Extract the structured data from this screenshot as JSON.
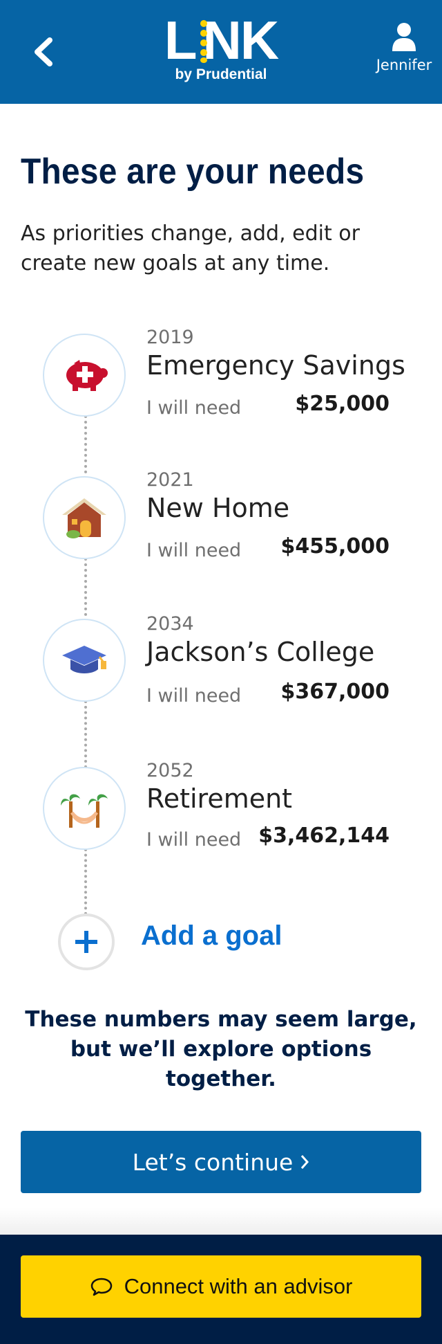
{
  "header": {
    "logo_word": "LINK",
    "logo_sub": "by Prudential",
    "user_name": "Jennifer"
  },
  "main": {
    "title": "These are your needs",
    "intro": "As priorities change, add, edit or create new goals at any time."
  },
  "goals": [
    {
      "year": "2019",
      "title": "Emergency Savings",
      "need_label": "I will need",
      "amount": "$25,000",
      "icon": "piggy-bank-icon"
    },
    {
      "year": "2021",
      "title": "New Home",
      "need_label": "I will need",
      "amount": "$455,000",
      "icon": "house-icon"
    },
    {
      "year": "2034",
      "title": "Jackson’s College",
      "need_label": "I will need",
      "amount": "$367,000",
      "icon": "graduation-cap-icon"
    },
    {
      "year": "2052",
      "title": "Retirement",
      "need_label": "I will need",
      "amount": "$3,462,144",
      "icon": "palm-tree-hammock-icon"
    }
  ],
  "add_goal": {
    "label": "Add a goal"
  },
  "note": "These numbers may seem large, but we’ll explore options together.",
  "continue_label": "Let’s continue",
  "footer": {
    "advisor_label": "Connect with an advisor"
  },
  "colors": {
    "brand_blue": "#0664a5",
    "navy": "#001e45",
    "yellow": "#ffd200",
    "link_blue": "#0a6fcf"
  }
}
